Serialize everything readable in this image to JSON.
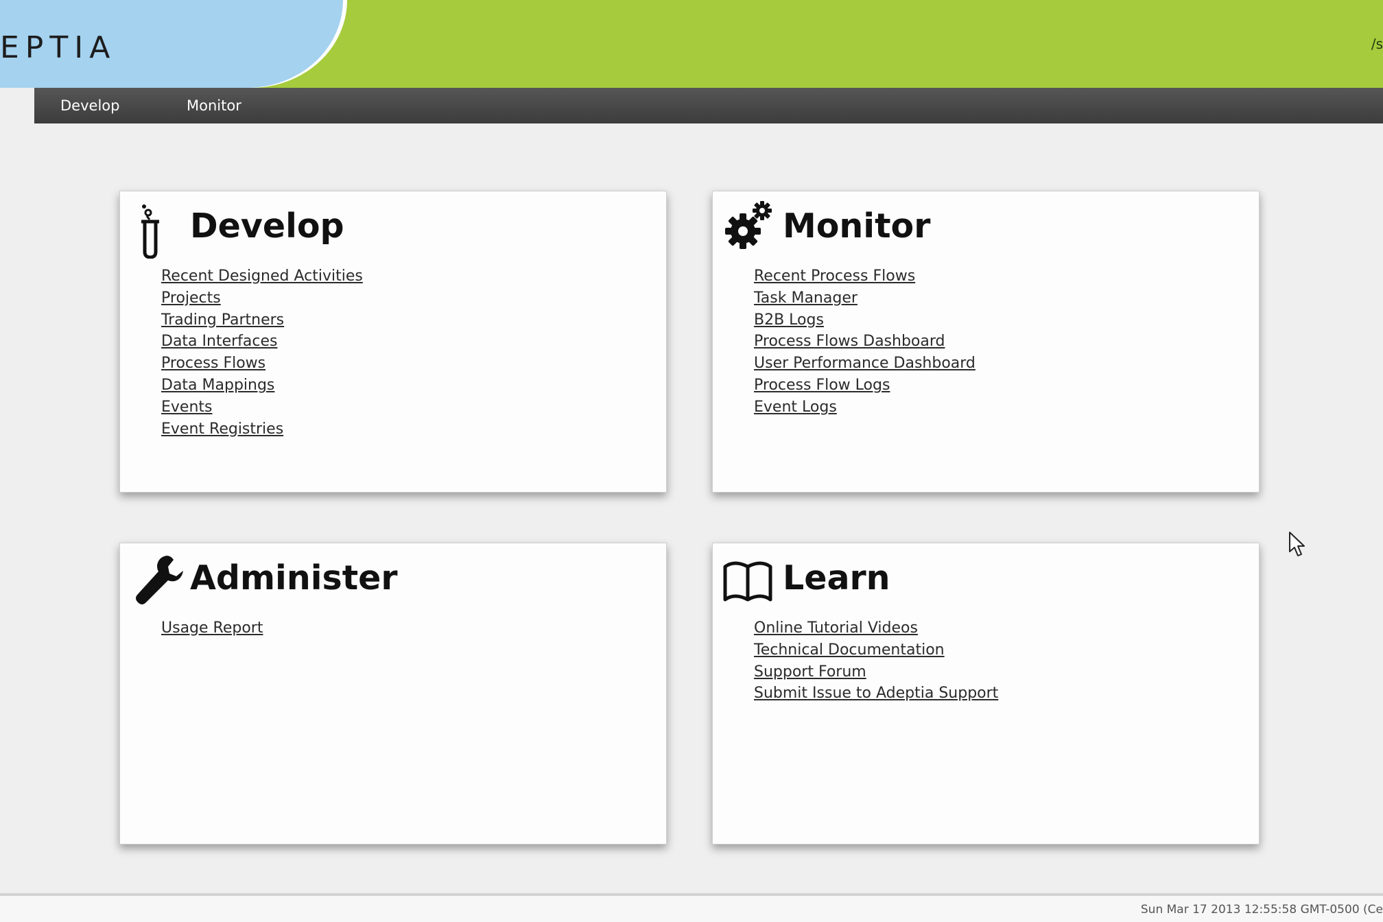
{
  "header": {
    "logo_text": "EPTIA",
    "right_fragment": "/s"
  },
  "nav": {
    "items": [
      {
        "label": "Develop"
      },
      {
        "label": "Monitor"
      }
    ]
  },
  "panels": {
    "develop": {
      "title": "Develop",
      "icon": "test-tube-icon",
      "links": [
        "Recent Designed Activities",
        "Projects",
        "Trading Partners",
        "Data Interfaces",
        "Process Flows",
        "Data Mappings",
        "Events",
        "Event Registries"
      ]
    },
    "monitor": {
      "title": "Monitor",
      "icon": "gears-icon",
      "links": [
        "Recent Process Flows",
        "Task Manager",
        "B2B Logs",
        "Process Flows Dashboard",
        "User Performance Dashboard",
        "Process Flow Logs",
        "Event Logs"
      ]
    },
    "administer": {
      "title": "Administer",
      "icon": "wrench-icon",
      "links": [
        "Usage Report"
      ]
    },
    "learn": {
      "title": "Learn",
      "icon": "open-book-icon",
      "links": [
        "Online Tutorial Videos",
        "Technical Documentation",
        "Support Forum",
        "Submit Issue to Adeptia Support"
      ]
    }
  },
  "footer": {
    "timestamp": "Sun Mar 17 2013 12:55:58 GMT-0500 (Ce"
  }
}
